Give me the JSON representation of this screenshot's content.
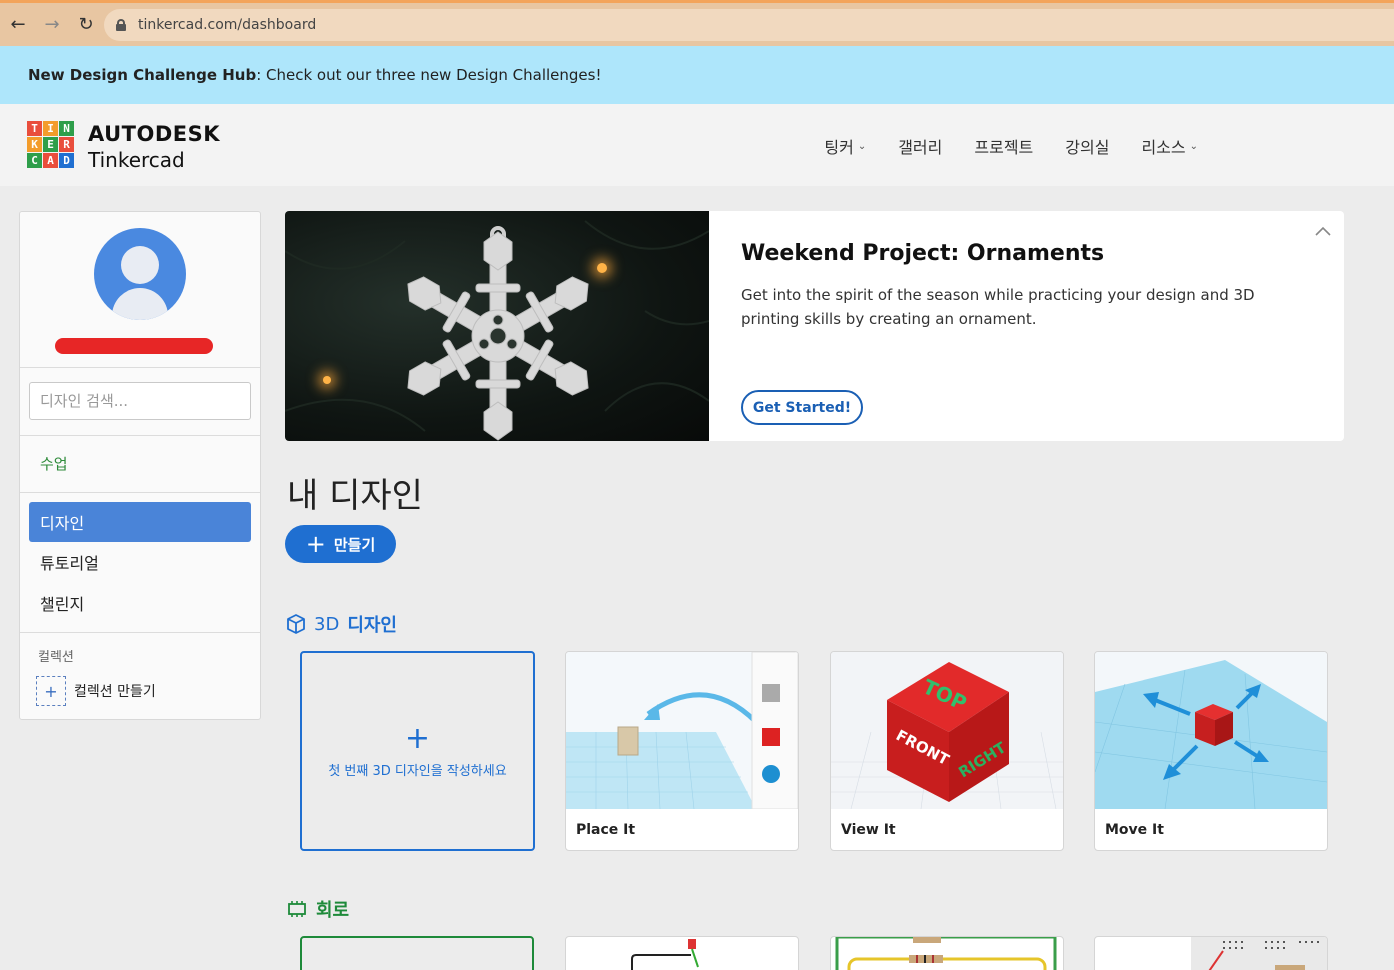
{
  "browser": {
    "url": "tinkercad.com/dashboard"
  },
  "announcement": {
    "bold": "New Design Challenge Hub",
    "text": ": Check out our three new Design Challenges!"
  },
  "header": {
    "logo_letters": [
      "T",
      "I",
      "N",
      "K",
      "E",
      "R",
      "C",
      "A",
      "D"
    ],
    "logo_colors": [
      "#e94e3c",
      "#f39c2b",
      "#2e9e4a",
      "#f39c2b",
      "#2e9e4a",
      "#e94e3c",
      "#2e9e4a",
      "#e94e3c",
      "#1f6fd1"
    ],
    "brand": "AUTODESK",
    "product": "Tinkercad",
    "nav": [
      {
        "label": "팅커",
        "dropdown": true
      },
      {
        "label": "갤러리",
        "dropdown": false
      },
      {
        "label": "프로젝트",
        "dropdown": false
      },
      {
        "label": "강의실",
        "dropdown": false
      },
      {
        "label": "리소스",
        "dropdown": true
      }
    ]
  },
  "sidebar": {
    "search_placeholder": "디자인 검색...",
    "classes": "수업",
    "items": [
      "디자인",
      "튜토리얼",
      "챌린지"
    ],
    "collections_heading": "컬렉션",
    "create_collection": "컬렉션 만들기"
  },
  "banner": {
    "title": "Weekend Project: Ornaments",
    "description": "Get into the spirit of the season while practicing your design and 3D printing skills by creating an ornament.",
    "button": "Get Started!"
  },
  "main": {
    "title": "내 디자인",
    "create_button": "만들기",
    "section_3d_prefix": "3D",
    "section_3d": "디자인",
    "new_design_text": "첫 번째 3D 디자인을 작성하세요",
    "cards": [
      "Place It",
      "View It",
      "Move It"
    ],
    "section_circuits": "회로"
  },
  "colors": {
    "accent_blue": "#1f6fd1",
    "active_item": "#4a84d8",
    "circuit_green": "#1e8a3a",
    "announce_bg": "#aee6fb"
  }
}
